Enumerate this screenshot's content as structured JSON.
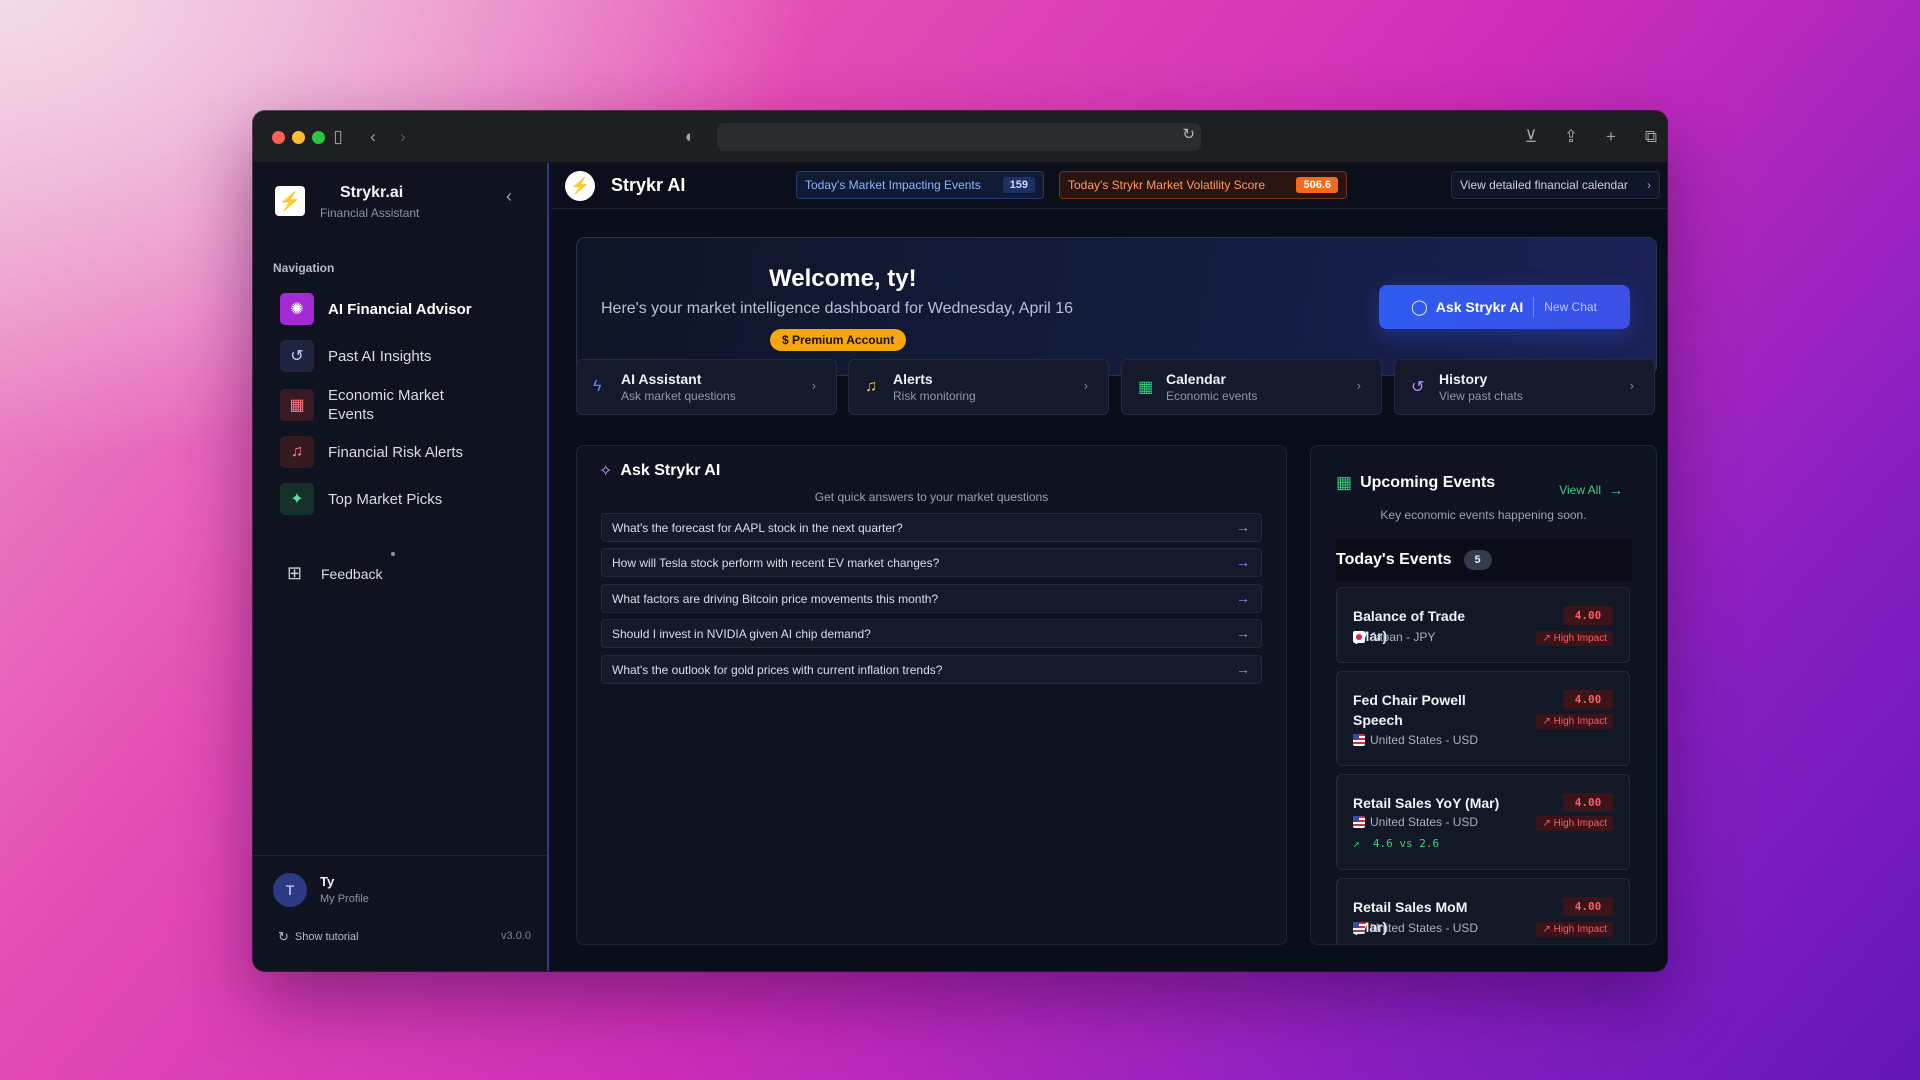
{
  "sidebar": {
    "brand_name": "Strykr.ai",
    "brand_sub": "Financial Assistant",
    "nav_title": "Navigation",
    "items": [
      {
        "label": "AI Financial Advisor",
        "icon": "brain-icon",
        "active": true
      },
      {
        "label": "Past AI Insights",
        "icon": "history-icon"
      },
      {
        "label": "Economic Market Events",
        "icon": "calendar-icon"
      },
      {
        "label": "Financial Risk Alerts",
        "icon": "bell-icon"
      },
      {
        "label": "Top Market Picks",
        "icon": "wand-icon"
      }
    ],
    "feedback_label": "Feedback",
    "user": {
      "initial": "T",
      "name": "Ty",
      "sub": "My Profile"
    },
    "tutorial_label": "Show tutorial",
    "version": "v3.0.0"
  },
  "topbar": {
    "title": "Strykr AI",
    "events_label": "Today's Market Impacting Events",
    "events_count": "159",
    "volatility_label": "Today's Strykr Market Volatility Score",
    "volatility_score": "506.6",
    "calendar_link": "View detailed financial calendar"
  },
  "welcome": {
    "title": "Welcome, ty!",
    "subtitle": "Here's your market intelligence dashboard for Wednesday, April 16",
    "badge": "$ Premium Account",
    "ask_button": "Ask Strykr AI",
    "new_chat": "New Chat"
  },
  "quick_cards": [
    {
      "title": "AI Assistant",
      "sub": "Ask market questions",
      "icon": "bolt-icon",
      "color": "#4d8dff"
    },
    {
      "title": "Alerts",
      "sub": "Risk monitoring",
      "icon": "bell-icon",
      "color": "#f5c242"
    },
    {
      "title": "Calendar",
      "sub": "Economic events",
      "icon": "calendar-icon",
      "color": "#36d17c"
    },
    {
      "title": "History",
      "sub": "View past chats",
      "icon": "history-icon",
      "color": "#b98cff"
    }
  ],
  "ask_panel": {
    "title": "Ask Strykr AI",
    "subtitle": "Get quick answers to your market questions",
    "questions": [
      "What's the forecast for AAPL stock in the next quarter?",
      "How will Tesla stock perform with recent EV market changes?",
      "What factors are driving Bitcoin price movements this month?",
      "Should I invest in NVIDIA given AI chip demand?",
      "What's the outlook for gold prices with current inflation trends?"
    ]
  },
  "events_panel": {
    "title": "Upcoming Events",
    "view_all": "View All",
    "subtitle": "Key economic events happening soon.",
    "today_label": "Today's Events",
    "today_count": "5",
    "events": [
      {
        "name": "Balance of Trade (Mar)",
        "country": "Japan - JPY",
        "flag": "jp",
        "value": "4.00",
        "impact": "High Impact"
      },
      {
        "name": "Fed Chair Powell Speech",
        "country": "United States - USD",
        "flag": "us",
        "value": "4.00",
        "impact": "High Impact"
      },
      {
        "name": "Retail Sales YoY (Mar)",
        "country": "United States - USD",
        "flag": "us",
        "value": "4.00",
        "impact": "High Impact",
        "actual": "4.6 vs 2.6"
      },
      {
        "name": "Retail Sales MoM (Mar)",
        "country": "United States - USD",
        "flag": "us",
        "value": "4.00",
        "impact": "High Impact"
      }
    ]
  },
  "colors": {
    "accent_blue": "#2f5bf0",
    "premium_gold": "#f5a70d",
    "volatility_orange": "#f26a1b",
    "impact_red": "#ff5a66",
    "positive_green": "#3ad27f"
  }
}
